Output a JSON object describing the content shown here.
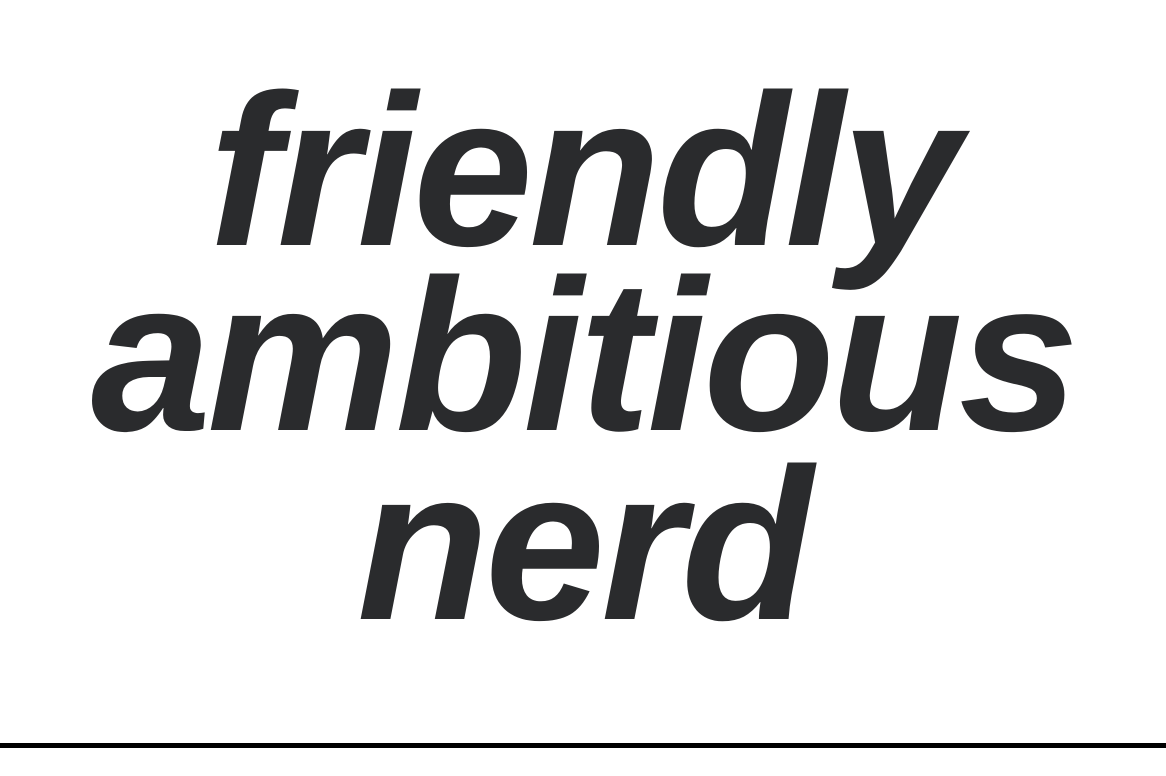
{
  "lines": [
    "friendly",
    "ambitious",
    "nerd"
  ],
  "colors": {
    "text": "#2a2b2d",
    "background": "#ffffff",
    "rule": "#000000"
  }
}
